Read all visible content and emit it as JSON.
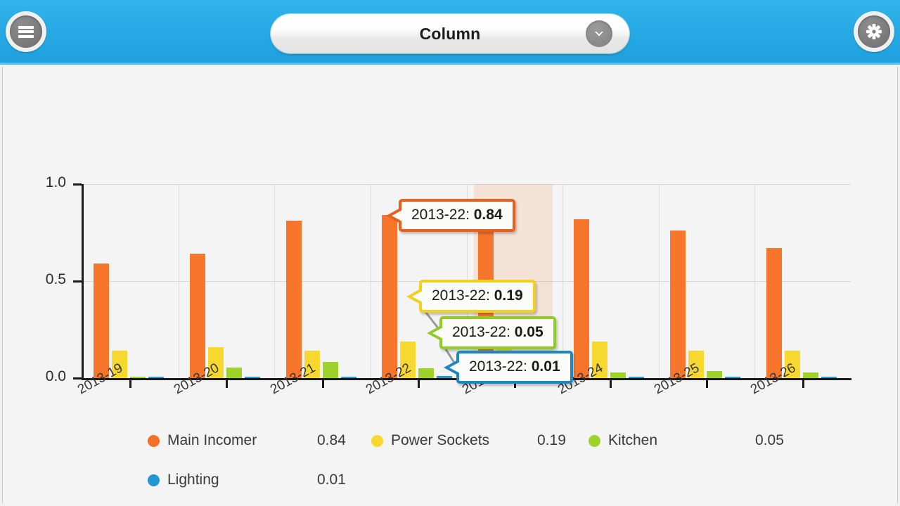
{
  "header": {
    "menu_icon": "hamburger-menu-icon",
    "settings_icon": "gear-icon",
    "dropdown_label": "Column",
    "dropdown_chevron_icon": "chevron-down-icon"
  },
  "chart_data": {
    "type": "bar",
    "title": "",
    "xlabel": "",
    "ylabel": "",
    "ylim": [
      0.0,
      1.0
    ],
    "yticks": [
      "0.0",
      "0.5",
      "1.0"
    ],
    "ytick_values": [
      0.0,
      0.5,
      1.0
    ],
    "grid": true,
    "legend_position": "bottom",
    "categories": [
      "2013-19",
      "2013-20",
      "2013-21",
      "2013-22",
      "2013-23",
      "2013-24",
      "2013-25",
      "2013-26"
    ],
    "highlighted_category": "2013-23",
    "series": [
      {
        "name": "Main Incomer",
        "color": "#f8762c",
        "values": [
          0.59,
          0.64,
          0.81,
          0.84,
          0.8,
          0.82,
          0.76,
          0.67
        ]
      },
      {
        "name": "Power Sockets",
        "color": "#f7d82e",
        "values": [
          0.14,
          0.16,
          0.14,
          0.19,
          0.15,
          0.19,
          0.14,
          0.14
        ]
      },
      {
        "name": "Kitchen",
        "color": "#9ed32c",
        "values": [
          0.005,
          0.055,
          0.085,
          0.05,
          0.03,
          0.03,
          0.035,
          0.03
        ]
      },
      {
        "name": "Lighting",
        "color": "#2196d3",
        "values": [
          0.008,
          0.008,
          0.008,
          0.01,
          0.008,
          0.008,
          0.006,
          0.006
        ]
      }
    ],
    "tooltips": [
      {
        "label": "2013-22:",
        "value": "0.84",
        "color": "#e8601c",
        "series": "Main Incomer"
      },
      {
        "label": "2013-22:",
        "value": "0.19",
        "color": "#f1d01e",
        "series": "Power Sockets"
      },
      {
        "label": "2013-22:",
        "value": "0.05",
        "color": "#8fcc27",
        "series": "Kitchen"
      },
      {
        "label": "2013-22:",
        "value": "0.01",
        "color": "#1d87c4",
        "series": "Lighting"
      }
    ]
  },
  "legend": {
    "entries": [
      {
        "name": "Main Incomer",
        "value": "0.84",
        "color": "#f4702a"
      },
      {
        "name": "Power Sockets",
        "value": "0.19",
        "color": "#f7d82e"
      },
      {
        "name": "Kitchen",
        "value": "0.05",
        "color": "#9ed32c"
      },
      {
        "name": "Lighting",
        "value": "0.01",
        "color": "#2196d3"
      }
    ]
  }
}
